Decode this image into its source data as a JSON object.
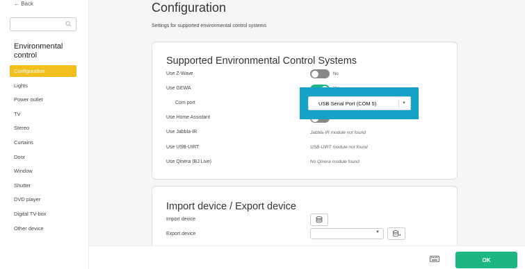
{
  "sidebar": {
    "back_label": "← Back",
    "search": {
      "value": "",
      "placeholder": ""
    },
    "section_title": "Environmental control",
    "items": [
      {
        "label": "Configuration",
        "active": true
      },
      {
        "label": "Lights"
      },
      {
        "label": "Power outlet"
      },
      {
        "label": "TV"
      },
      {
        "label": "Stereo"
      },
      {
        "label": "Curtains"
      },
      {
        "label": "Door"
      },
      {
        "label": "Window"
      },
      {
        "label": "Shutter"
      },
      {
        "label": "DVD player"
      },
      {
        "label": "Digital TV-box"
      },
      {
        "label": "Other device"
      }
    ]
  },
  "main": {
    "title": "Configuration",
    "subtitle": "Settings for supported environmental control systems",
    "systems_card": {
      "title": "Supported Environmental Control Systems",
      "zwave": {
        "label": "Use Z-Wave",
        "state": "No",
        "on": false
      },
      "gewa": {
        "label": "Use GEWA",
        "state": "Yes",
        "on": true
      },
      "com_port": {
        "label": "Com port",
        "selected": "USB Serial Port (COM 5)"
      },
      "home_assistant": {
        "label": "Use Home Assistant",
        "state": "No",
        "on": false
      },
      "jabbla": {
        "label": "Use Jabbla-IR",
        "value": "Jabbla-IR module not found"
      },
      "usb_uirt": {
        "label": "Use USB-UIRT",
        "value": "USB-UIRT module not found"
      },
      "qinera": {
        "label": "Use Qinera (BJ Live)",
        "value": "No Qinera module found"
      }
    },
    "import_card": {
      "title": "Import device / Export device",
      "import_label": "Import device",
      "export_label": "Export device",
      "export_selected": ""
    }
  },
  "footer": {
    "ok_label": "OK"
  },
  "colors": {
    "accent_yellow": "#f2c01e",
    "toggle_on": "#1db583",
    "highlight": "#14a3c7",
    "ok_button": "#1db583"
  }
}
